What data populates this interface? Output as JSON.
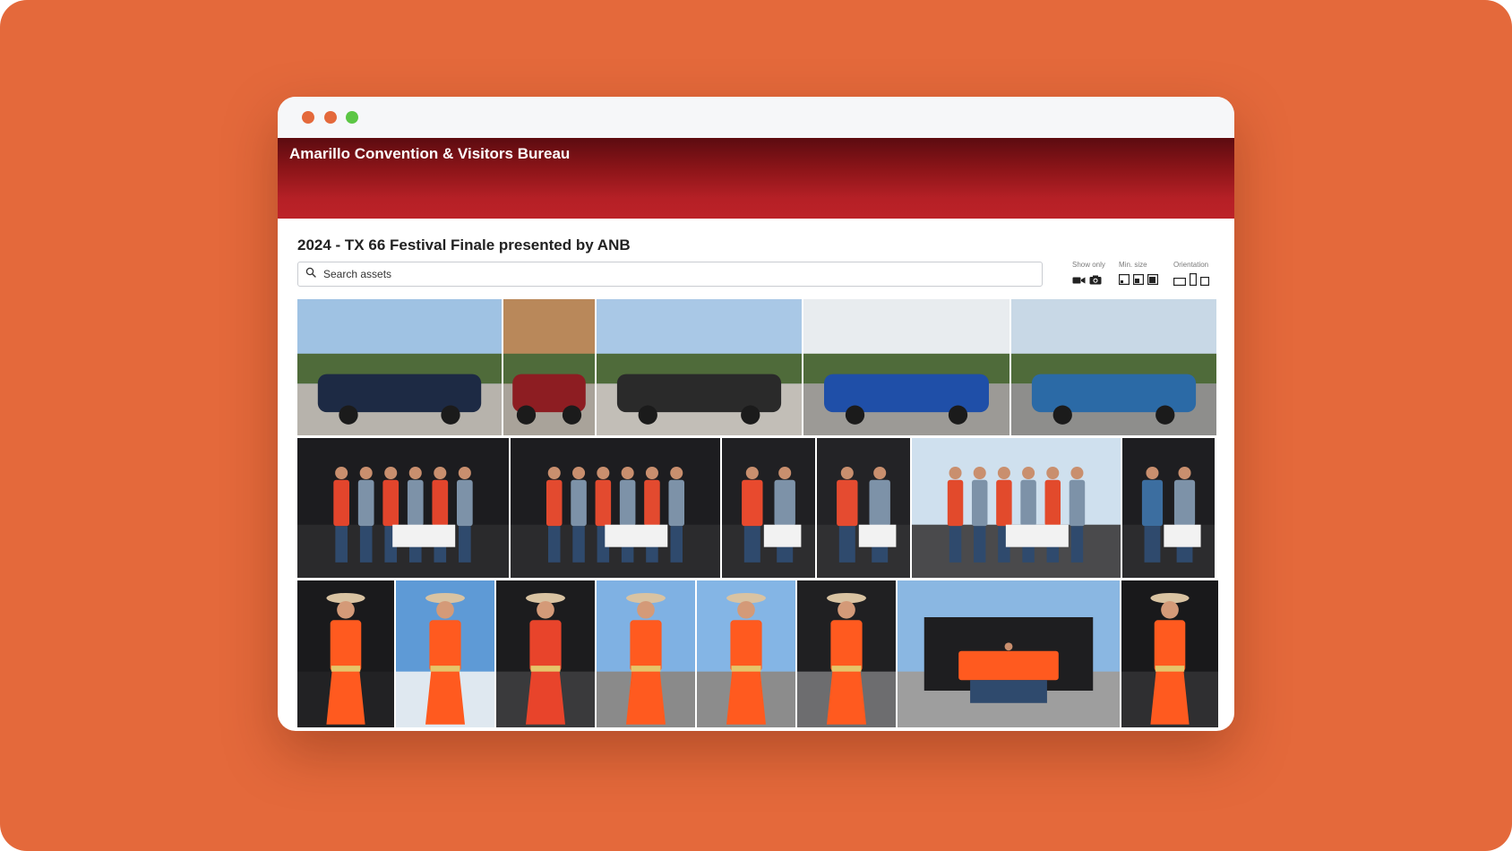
{
  "window": {
    "dots": [
      "#e4693b",
      "#e4693b",
      "#5cc645"
    ]
  },
  "header": {
    "org_name": "Amarillo Convention & Visitors Bureau"
  },
  "collection": {
    "title": "2024 - TX 66 Festival Finale presented by ANB"
  },
  "search": {
    "placeholder": "Search assets",
    "icon": "search-icon"
  },
  "filters": {
    "show_only": {
      "label": "Show only",
      "icons": [
        "video-camera-icon",
        "photo-camera-icon"
      ]
    },
    "min_size": {
      "label": "Min. size",
      "icons": [
        "small-size-icon",
        "medium-size-icon",
        "large-size-icon"
      ]
    },
    "orientation": {
      "label": "Orientation",
      "icons": [
        "landscape-icon",
        "portrait-icon",
        "square-icon"
      ]
    }
  },
  "gallery": {
    "rows": [
      {
        "name": "car-show",
        "photos": [
          {
            "scene": "street-walkers",
            "sky": "#9fc2e3",
            "ground": "#b7b3ac",
            "accent": "#1d2a44"
          },
          {
            "scene": "woman-by-building",
            "sky": "#b9885a",
            "ground": "#a9a39a",
            "accent": "#8d1d22"
          },
          {
            "scene": "street-crowd",
            "sky": "#a9c8e6",
            "ground": "#c2beb7",
            "accent": "#2a2a2a"
          },
          {
            "scene": "blue-cobra",
            "sky": "#e8ecef",
            "ground": "#9c9a96",
            "accent": "#1f4fa8"
          },
          {
            "scene": "blue-chevy",
            "sky": "#c8d8e6",
            "ground": "#8e8e8c",
            "accent": "#2b6aa6"
          }
        ]
      },
      {
        "name": "award-stage",
        "photos": [
          {
            "scene": "group-with-check",
            "sky": "#1c1c1f",
            "ground": "#2a2a2c",
            "accent": "#e2452c"
          },
          {
            "scene": "group-with-check-2",
            "sky": "#1d1d20",
            "ground": "#2b2b2d",
            "accent": "#e34a2f"
          },
          {
            "scene": "family-check",
            "sky": "#202023",
            "ground": "#2d2d2f",
            "accent": "#e84a2e"
          },
          {
            "scene": "family-pair",
            "sky": "#232326",
            "ground": "#303032",
            "accent": "#e54b30"
          },
          {
            "scene": "stage-outdoor",
            "sky": "#cfe0ee",
            "ground": "#4a4a4c",
            "accent": "#e24a2c"
          },
          {
            "scene": "woman-check",
            "sky": "#1e1e21",
            "ground": "#2c2c2e",
            "accent": "#3c6ea0"
          }
        ]
      },
      {
        "name": "performer",
        "photos": [
          {
            "scene": "performer-mic",
            "sky": "#1a1a1c",
            "ground": "#222224",
            "accent": "#ff5a1f"
          },
          {
            "scene": "performer-sky",
            "sky": "#5e9ad6",
            "ground": "#dfe8f0",
            "accent": "#ff5a1f"
          },
          {
            "scene": "man-award",
            "sky": "#1c1c1e",
            "ground": "#3a3a3c",
            "accent": "#e8442b"
          },
          {
            "scene": "performer-point",
            "sky": "#7fb1e3",
            "ground": "#8a8a8a",
            "accent": "#ff5a1f"
          },
          {
            "scene": "performer-board",
            "sky": "#84b5e5",
            "ground": "#8c8c8c",
            "accent": "#ff5a1f"
          },
          {
            "scene": "performer-stage",
            "sky": "#202022",
            "ground": "#6d6d6f",
            "accent": "#ff5a1f"
          },
          {
            "scene": "wide-stage",
            "sky": "#8ab7e2",
            "ground": "#9e9e9e",
            "accent": "#ff5a1f"
          },
          {
            "scene": "performer-dark",
            "sky": "#19191b",
            "ground": "#2f2f31",
            "accent": "#ff5a1f"
          }
        ]
      }
    ]
  }
}
